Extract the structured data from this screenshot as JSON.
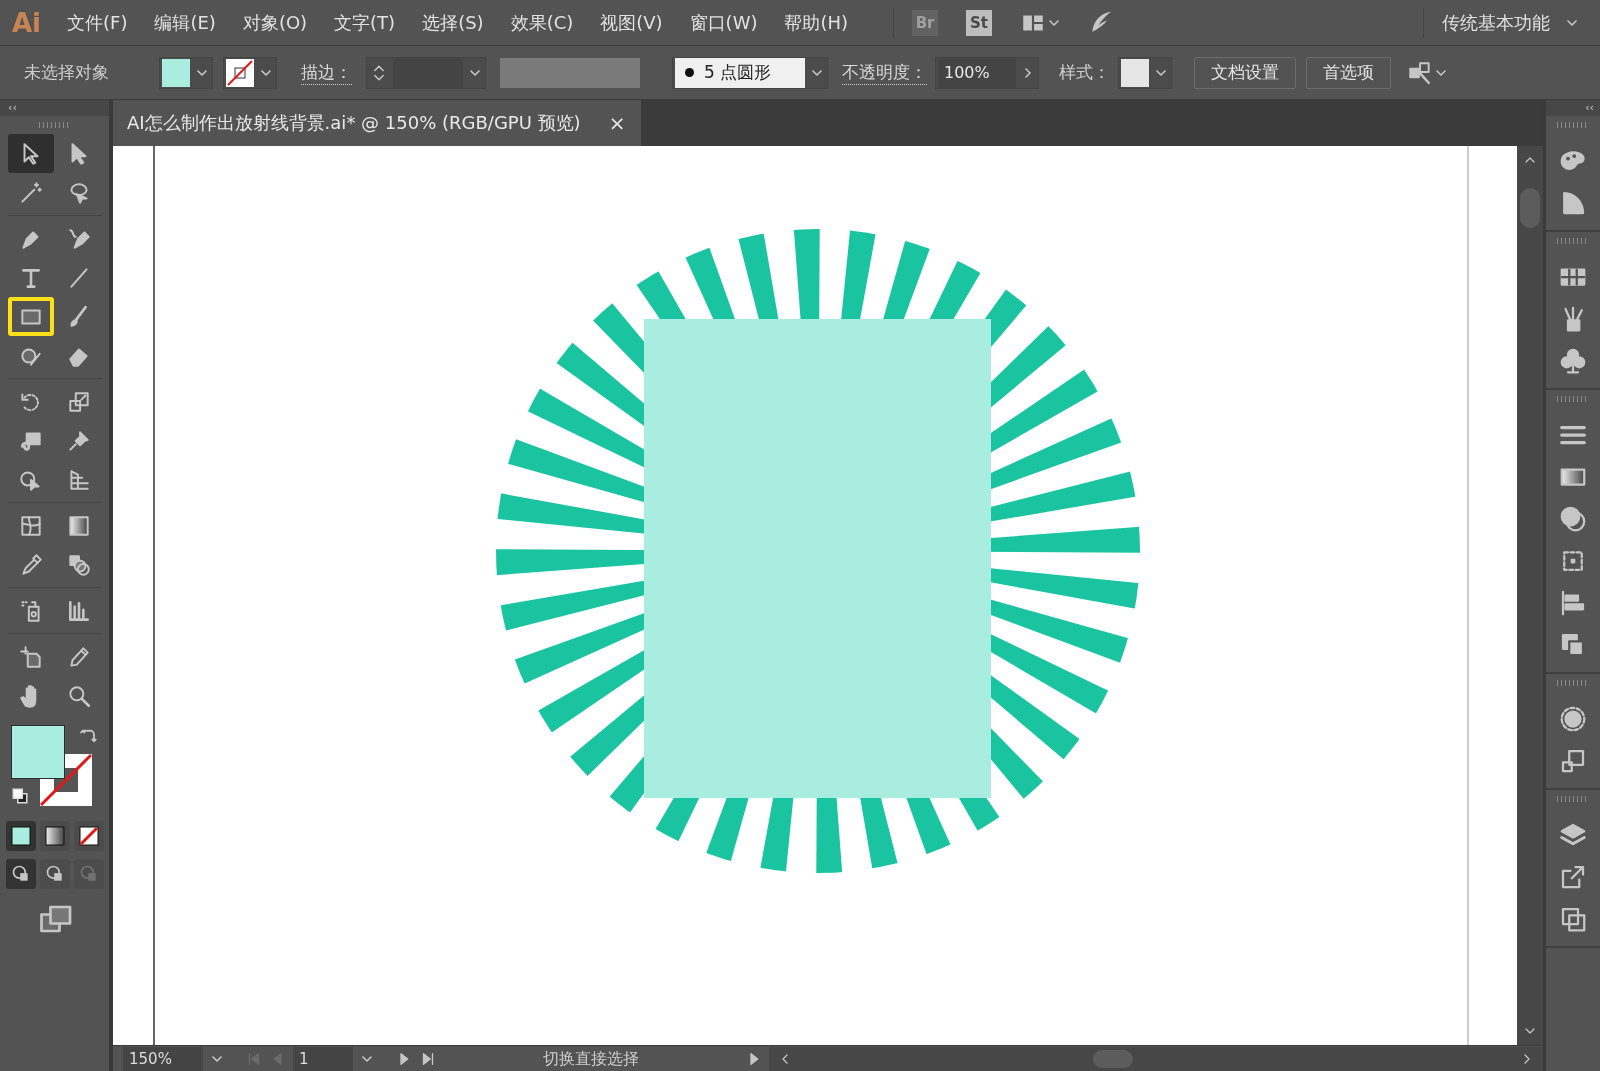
{
  "app": {
    "logo": "Ai",
    "workspace": "传统基本功能"
  },
  "panel_toggles": [
    "‹‹",
    "‹‹"
  ],
  "menu": [
    "文件(F)",
    "编辑(E)",
    "对象(O)",
    "文字(T)",
    "选择(S)",
    "效果(C)",
    "视图(V)",
    "窗口(W)",
    "帮助(H)"
  ],
  "app_buttons": [
    {
      "label": "Br",
      "disabled": true
    },
    {
      "label": "St",
      "disabled": false
    }
  ],
  "control_bar": {
    "selection": "未选择对象",
    "stroke_label": "描边：",
    "brush": "5 点圆形",
    "opacity_label": "不透明度：",
    "opacity": "100%",
    "style_label": "样式：",
    "buttons": [
      "文档设置",
      "首选项"
    ]
  },
  "document_tab": {
    "title": "AI怎么制作出放射线背景.ai* @ 150% (RGB/GPU 预览)",
    "close": "×"
  },
  "tools": [
    {
      "selected": true,
      "highlighted": false
    },
    {
      "selected": false,
      "highlighted": false
    },
    {
      "selected": false,
      "highlighted": false
    },
    {
      "selected": false,
      "highlighted": false
    },
    {
      "selected": false,
      "highlighted": false
    },
    {
      "selected": false,
      "highlighted": false
    },
    {
      "selected": false,
      "highlighted": false
    },
    {
      "selected": false,
      "highlighted": false
    },
    {
      "selected": false,
      "highlighted": true
    },
    {
      "selected": false,
      "highlighted": false
    },
    {
      "selected": false,
      "highlighted": false
    },
    {
      "selected": false,
      "highlighted": false
    },
    {
      "selected": false,
      "highlighted": false
    },
    {
      "selected": false,
      "highlighted": false
    },
    {
      "selected": false,
      "highlighted": false
    },
    {
      "selected": false,
      "highlighted": false
    },
    {
      "selected": false,
      "highlighted": false
    },
    {
      "selected": false,
      "highlighted": false
    },
    {
      "selected": false,
      "highlighted": false
    },
    {
      "selected": false,
      "highlighted": false
    },
    {
      "selected": false,
      "highlighted": false
    },
    {
      "selected": false,
      "highlighted": false
    },
    {
      "selected": false,
      "highlighted": false
    },
    {
      "selected": false,
      "highlighted": false
    },
    {
      "selected": false,
      "highlighted": false
    },
    {
      "selected": false,
      "highlighted": false
    },
    {
      "selected": false,
      "highlighted": false
    },
    {
      "selected": false,
      "highlighted": false
    }
  ],
  "color_modes": [
    {
      "selected": true
    },
    {
      "selected": false
    },
    {
      "selected": false
    }
  ],
  "draw_modes": [
    {
      "selected": true,
      "disabled": false
    },
    {
      "selected": false,
      "disabled": false
    },
    {
      "selected": false,
      "disabled": true
    }
  ],
  "status_bar": {
    "zoom": "150%",
    "page": "1",
    "status": "切换直接选择"
  }
}
